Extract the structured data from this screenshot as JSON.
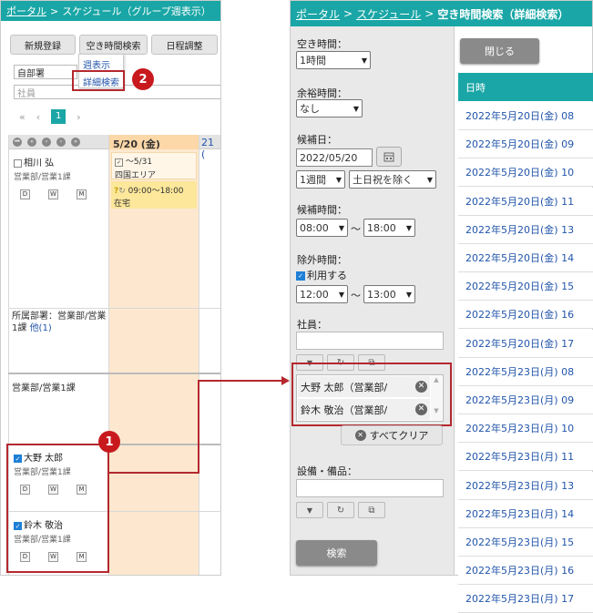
{
  "left": {
    "breadcrumb": {
      "portal": "ポータル",
      "sep": ">",
      "page": "スケジュール（グループ週表示）"
    },
    "toolbar": {
      "new": "新規登録",
      "free_search": "空き時間検索",
      "adjust": "日程調整"
    },
    "dropdown": {
      "week": "週表示",
      "detail": "詳細検索"
    },
    "dept_select": "自部署",
    "employee_placeholder": "社員",
    "pager": {
      "first": "«",
      "prev": "‹",
      "page": "1",
      "next": "›"
    },
    "date_header": {
      "d1": "5/20 (金)",
      "d2": "21 ("
    },
    "user1": {
      "name": "相川 弘",
      "dept": "営業部/営業1課"
    },
    "event1": {
      "date": "～5/31",
      "place": "四国エリア"
    },
    "event2": {
      "time": "09:00～18:00",
      "place": "在宅"
    },
    "dwm": {
      "d": "D",
      "w": "W",
      "m": "M"
    },
    "section1": {
      "label": "所属部署：営業部/営業1課",
      "more": "他(1)"
    },
    "section2": {
      "label": "営業部/営業1課"
    },
    "user2": {
      "name": "大野 太郎",
      "dept": "営業部/営業1課"
    },
    "user3": {
      "name": "鈴木 敬治",
      "dept": "営業部/営業1課"
    }
  },
  "right": {
    "breadcrumb": {
      "portal": "ポータル",
      "sep": ">",
      "schedule": "スケジュール",
      "page": "空き時間検索（詳細検索）"
    },
    "close": "閉じる",
    "free_time": {
      "label": "空き時間：",
      "value": "1時間"
    },
    "margin_time": {
      "label": "余裕時間：",
      "value": "なし"
    },
    "candidate_date": {
      "label": "候補日：",
      "value": "2022/05/20",
      "period": "1週間",
      "exclude": "土日祝を除く"
    },
    "candidate_time": {
      "label": "候補時間：",
      "from": "08:00",
      "tilde": "～",
      "to": "18:00"
    },
    "excluded_time": {
      "label": "除外時間：",
      "use": "利用する",
      "from": "12:00",
      "tilde": "～",
      "to": "13:00"
    },
    "employee": {
      "label": "社員：",
      "list": [
        "大野 太郎（営業部/",
        "鈴木 敬治（営業部/"
      ],
      "clear_all": "すべてクリア"
    },
    "equipment": {
      "label": "設備・備品："
    },
    "search": "検索",
    "table": {
      "header": "日時",
      "rows": [
        "2022年5月20日(金) 08",
        "2022年5月20日(金) 09",
        "2022年5月20日(金) 10",
        "2022年5月20日(金) 11",
        "2022年5月20日(金) 13",
        "2022年5月20日(金) 14",
        "2022年5月20日(金) 15",
        "2022年5月20日(金) 16",
        "2022年5月20日(金) 17",
        "2022年5月23日(月) 08",
        "2022年5月23日(月) 09",
        "2022年5月23日(月) 10",
        "2022年5月23日(月) 11",
        "2022年5月23日(月) 13",
        "2022年5月23日(月) 14",
        "2022年5月23日(月) 15",
        "2022年5月23日(月) 16",
        "2022年5月23日(月) 17"
      ]
    }
  },
  "callouts": {
    "one": "1",
    "two": "2"
  },
  "colors": {
    "teal": "#1aa6a6",
    "accent_red": "#c8191e",
    "calendar_today": "#fde8cf",
    "event_yellow": "#fce79a",
    "panel_gray": "#e9e9e9"
  }
}
